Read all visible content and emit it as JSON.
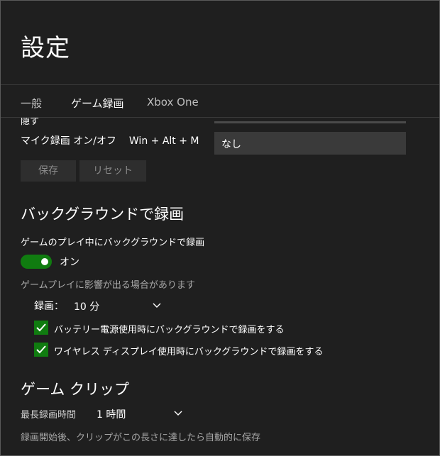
{
  "window": {
    "title": "設定"
  },
  "tabs": [
    {
      "label": "一般"
    },
    {
      "label": "ゲーム録画"
    },
    {
      "label": "Xbox One"
    }
  ],
  "shortcuts": {
    "cutoff_text": "隠す",
    "mic_label": "マイク録画 オン/オフ",
    "mic_combo": "Win + Alt + M",
    "mic_input_value": "なし",
    "save_label": "保存",
    "reset_label": "リセット"
  },
  "background": {
    "title": "バックグラウンドで録画",
    "toggle_label": "ゲームのプレイ中にバックグラウンドで録画",
    "toggle_state": "オン",
    "accent_color": "#107c10",
    "warning": "ゲームプレイに影響が出る場合があります",
    "duration_label": "録画：",
    "duration_value": "10 分",
    "checkbox_battery": "バッテリー電源使用時にバックグラウンドで録画をする",
    "checkbox_wireless": "ワイヤレス ディスプレイ使用時にバックグラウンドで録画をする"
  },
  "clip": {
    "title": "ゲーム クリップ",
    "max_label": "最長録画時間",
    "max_value": "1 時間",
    "note": "録画開始後、クリップがこの長さに達したら自動的に保存"
  }
}
